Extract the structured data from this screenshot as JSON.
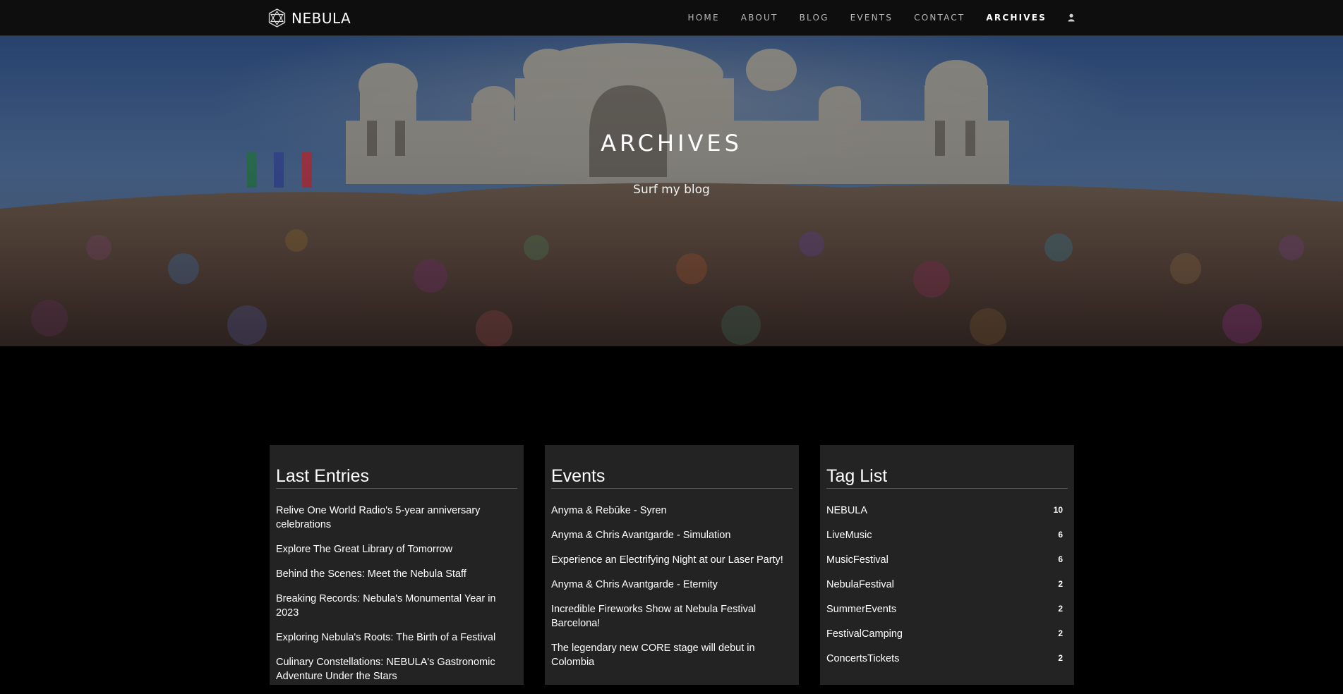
{
  "brand": {
    "name": "NEBULA",
    "icon": "star-of-david-logo-icon"
  },
  "nav": {
    "items": [
      {
        "label": "HOME",
        "active": false
      },
      {
        "label": "ABOUT",
        "active": false
      },
      {
        "label": "BLOG",
        "active": false
      },
      {
        "label": "EVENTS",
        "active": false
      },
      {
        "label": "CONTACT",
        "active": false
      },
      {
        "label": "ARCHIVES",
        "active": true
      }
    ],
    "user_icon": "user-icon"
  },
  "hero": {
    "title": "ARCHIVES",
    "subtitle": "Surf my blog"
  },
  "last_entries": {
    "title": "Last Entries",
    "items": [
      "Relive One World Radio's 5-year anniversary celebrations",
      "Explore The Great Library of Tomorrow",
      "Behind the Scenes: Meet the Nebula Staff",
      "Breaking Records: Nebula's Monumental Year in 2023",
      "Exploring Nebula's Roots: The Birth of a Festival",
      "Culinary Constellations: NEBULA's Gastronomic Adventure Under the Stars"
    ]
  },
  "events": {
    "title": "Events",
    "items": [
      "Anyma & Rebūke - Syren",
      "Anyma & Chris Avantgarde - Simulation",
      "Experience an Electrifying Night at our Laser Party!",
      "Anyma & Chris Avantgarde - Eternity",
      "Incredible Fireworks Show at Nebula Festival Barcelona!",
      "The legendary new CORE stage will debut in Colombia"
    ]
  },
  "tags": {
    "title": "Tag List",
    "items": [
      {
        "name": "NEBULA",
        "count": "10"
      },
      {
        "name": "LiveMusic",
        "count": "6"
      },
      {
        "name": "MusicFestival",
        "count": "6"
      },
      {
        "name": "NebulaFestival",
        "count": "2"
      },
      {
        "name": "SummerEvents",
        "count": "2"
      },
      {
        "name": "FestivalCamping",
        "count": "2"
      },
      {
        "name": "ConcertsTickets",
        "count": "2"
      }
    ]
  }
}
